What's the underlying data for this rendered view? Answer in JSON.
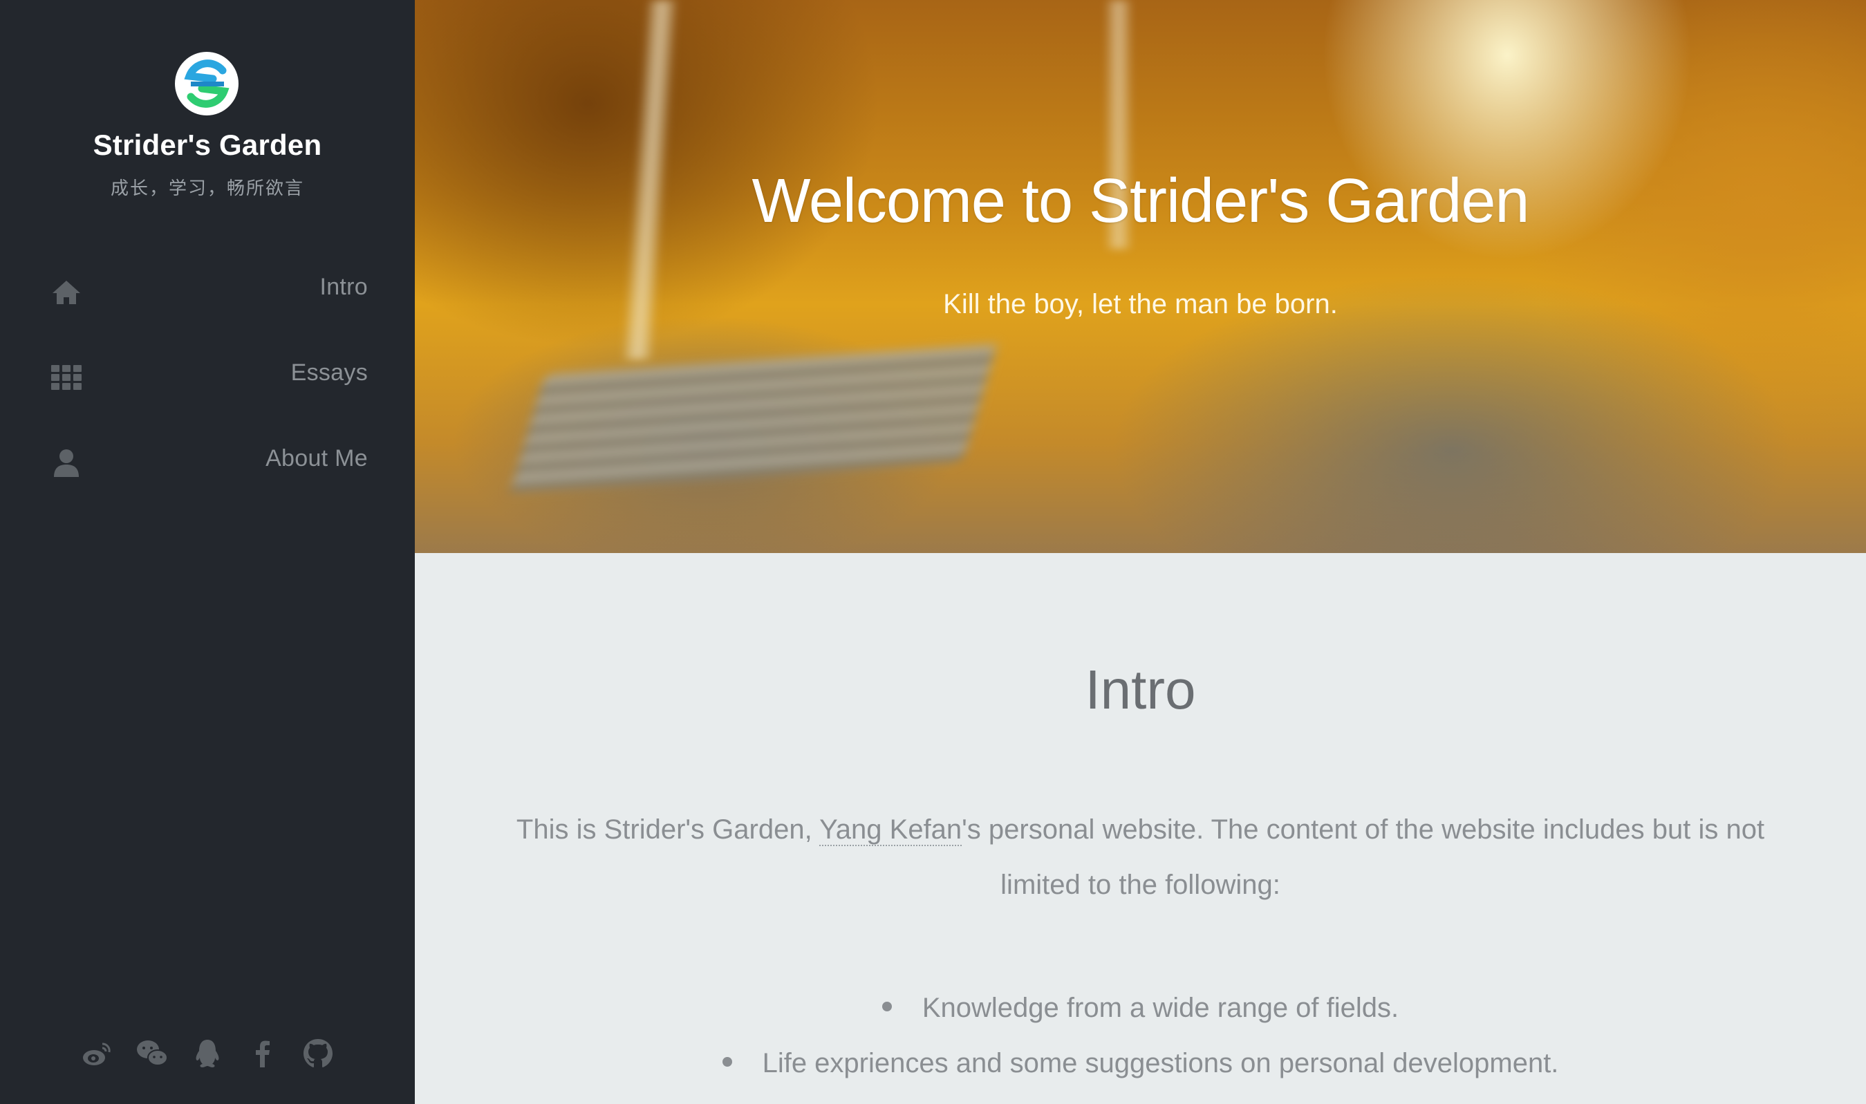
{
  "sidebar": {
    "title": "Strider's Garden",
    "subtitle": "成长，学习，畅所欲言",
    "logo_icon": "strider-logo-icon",
    "nav": [
      {
        "label": "Intro",
        "icon": "home-icon"
      },
      {
        "label": "Essays",
        "icon": "grid-icon"
      },
      {
        "label": "About Me",
        "icon": "user-icon"
      }
    ],
    "social": [
      "weibo-icon",
      "wechat-icon",
      "qq-icon",
      "facebook-icon",
      "github-icon"
    ]
  },
  "hero": {
    "title": "Welcome to Strider's Garden",
    "subtitle": "Kill the boy, let the man be born."
  },
  "intro": {
    "heading": "Intro",
    "para_before": "This is Strider's Garden, ",
    "para_link": "Yang Kefan",
    "para_after": "'s personal website. The content of the website includes but is not limited to the following:",
    "bullets": [
      "Knowledge from a wide range of fields.",
      "Life expriences and some suggestions on personal development."
    ]
  },
  "colors": {
    "sidebar_bg": "#23272d",
    "content_bg": "#e8eced",
    "logo_blue": "#2aa6e0",
    "logo_green": "#2ecc71"
  }
}
